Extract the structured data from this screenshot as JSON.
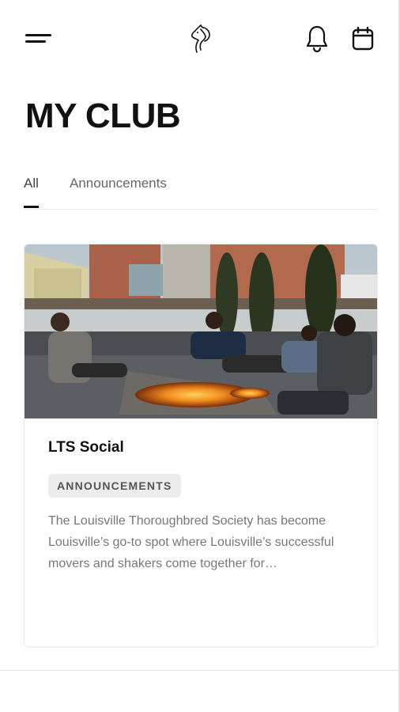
{
  "header": {
    "menu_icon": "hamburger-menu-icon",
    "logo_icon": "horse-head-logo-icon",
    "notifications_icon": "bell-icon",
    "calendar_icon": "calendar-icon"
  },
  "page": {
    "title": "MY CLUB"
  },
  "tabs": [
    {
      "label": "All",
      "active": true
    },
    {
      "label": "Announcements",
      "active": false
    }
  ],
  "posts": [
    {
      "title": "LTS Social",
      "category": "ANNOUNCEMENTS",
      "excerpt": "The Louisville Thoroughbred Society has become Louisville’s go-to spot where Louisville’s successful movers and shakers come together for…",
      "image": "rooftop-fire-pit-gathering-photo"
    }
  ],
  "colors": {
    "text_primary": "#111111",
    "text_muted": "#777777",
    "badge_bg": "#ececec",
    "divider": "#ececec"
  }
}
